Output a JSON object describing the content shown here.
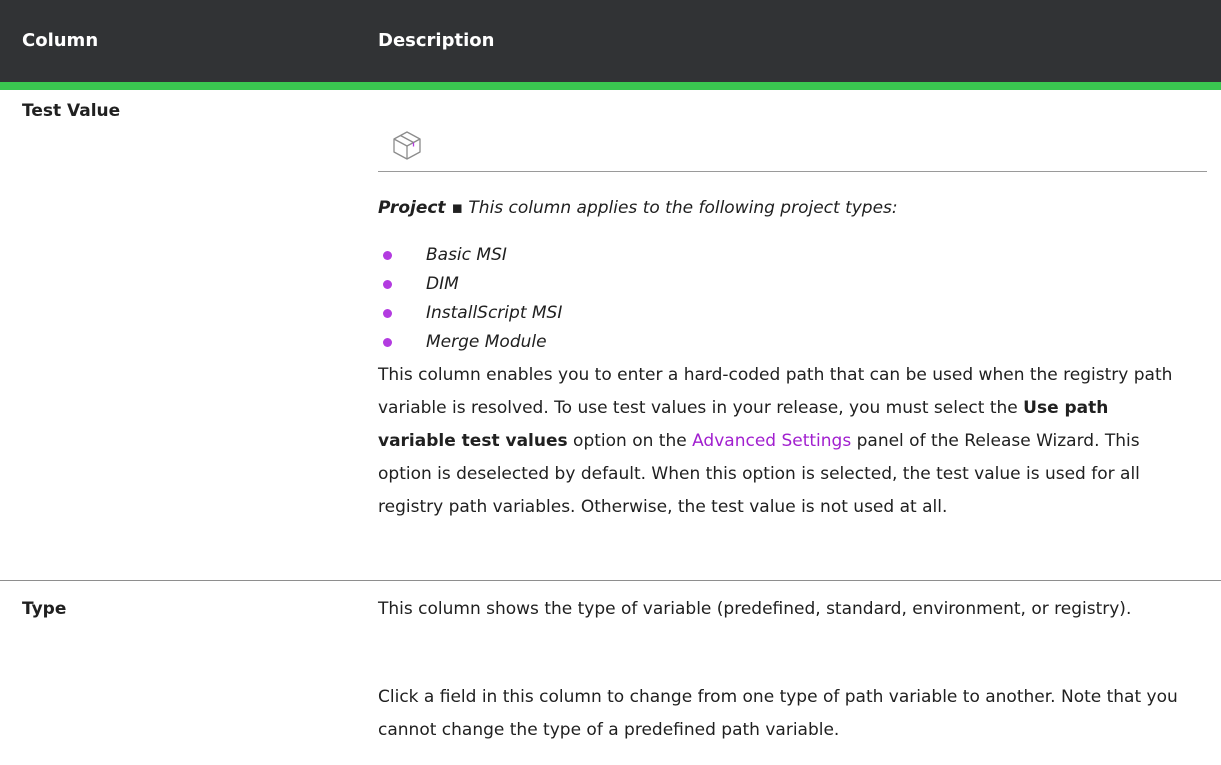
{
  "header": {
    "column": "Column",
    "description": "Description"
  },
  "colors": {
    "header_bg": "#313335",
    "accent_green": "#3ac650",
    "bullet_purple": "#b33be0",
    "link_purple": "#a11fcf"
  },
  "rows": [
    {
      "label": "Test Value",
      "icon": "package-box-icon",
      "project_prefix": "Project ▪",
      "project_text": "This column applies to the following project types:",
      "project_types": [
        "Basic MSI",
        "DIM",
        "InstallScript MSI",
        "Merge Module"
      ],
      "paragraph": {
        "t1": "This column enables you to enter a hard-coded path that can be used when the registry path variable is resolved. To use test values in your release, you must select the ",
        "bold": "Use path variable test values",
        "t2": " option on the ",
        "link": "Advanced Settings",
        "t3": " panel of the Release Wizard. This option is deselected by default. When this option is selected, the test value is used for all registry path variables. Otherwise, the test value is not used at all."
      }
    },
    {
      "label": "Type",
      "para1": "This column shows the type of variable (predefined, standard, environment, or registry).",
      "para2": "Click a field in this column to change from one type of path variable to another. Note that you cannot change the type of a predefined path variable."
    }
  ]
}
